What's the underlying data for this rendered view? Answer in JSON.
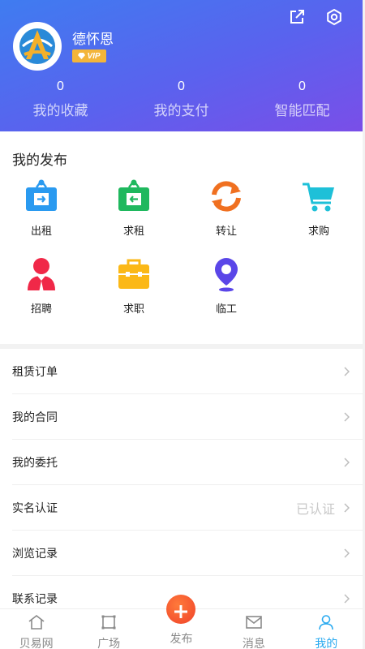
{
  "header": {
    "username": "德怀恩",
    "vip_label": "VIP",
    "stats": [
      {
        "count": "0",
        "label": "我的收藏"
      },
      {
        "count": "0",
        "label": "我的支付"
      },
      {
        "count": "0",
        "label": "智能匹配"
      }
    ],
    "icons": [
      "share-icon",
      "settings-icon"
    ]
  },
  "publish": {
    "title": "我的发布",
    "items": [
      {
        "label": "出租",
        "icon": "rent-out-icon",
        "color": "#2a9af0"
      },
      {
        "label": "求租",
        "icon": "rent-seek-icon",
        "color": "#1fb85e"
      },
      {
        "label": "转让",
        "icon": "transfer-icon",
        "color": "#f07020"
      },
      {
        "label": "求购",
        "icon": "cart-icon",
        "color": "#1ec0d8"
      },
      {
        "label": "招聘",
        "icon": "recruit-icon",
        "color": "#f02848"
      },
      {
        "label": "求职",
        "icon": "briefcase-icon",
        "color": "#fbb817"
      },
      {
        "label": "临工",
        "icon": "location-icon",
        "color": "#5a46e8"
      }
    ]
  },
  "menu": {
    "items": [
      {
        "label": "租赁订单",
        "value": ""
      },
      {
        "label": "我的合同",
        "value": ""
      },
      {
        "label": "我的委托",
        "value": ""
      },
      {
        "label": "实名认证",
        "value": "已认证"
      },
      {
        "label": "浏览记录",
        "value": ""
      },
      {
        "label": "联系记录",
        "value": ""
      }
    ]
  },
  "tabbar": {
    "tabs": [
      {
        "label": "贝易网",
        "icon": "home-icon"
      },
      {
        "label": "广场",
        "icon": "square-icon"
      },
      {
        "label": "发布",
        "icon": "plus-icon"
      },
      {
        "label": "消息",
        "icon": "mail-icon"
      },
      {
        "label": "我的",
        "icon": "user-icon"
      }
    ],
    "active": "我的",
    "active_color": "#2aaaf0"
  }
}
